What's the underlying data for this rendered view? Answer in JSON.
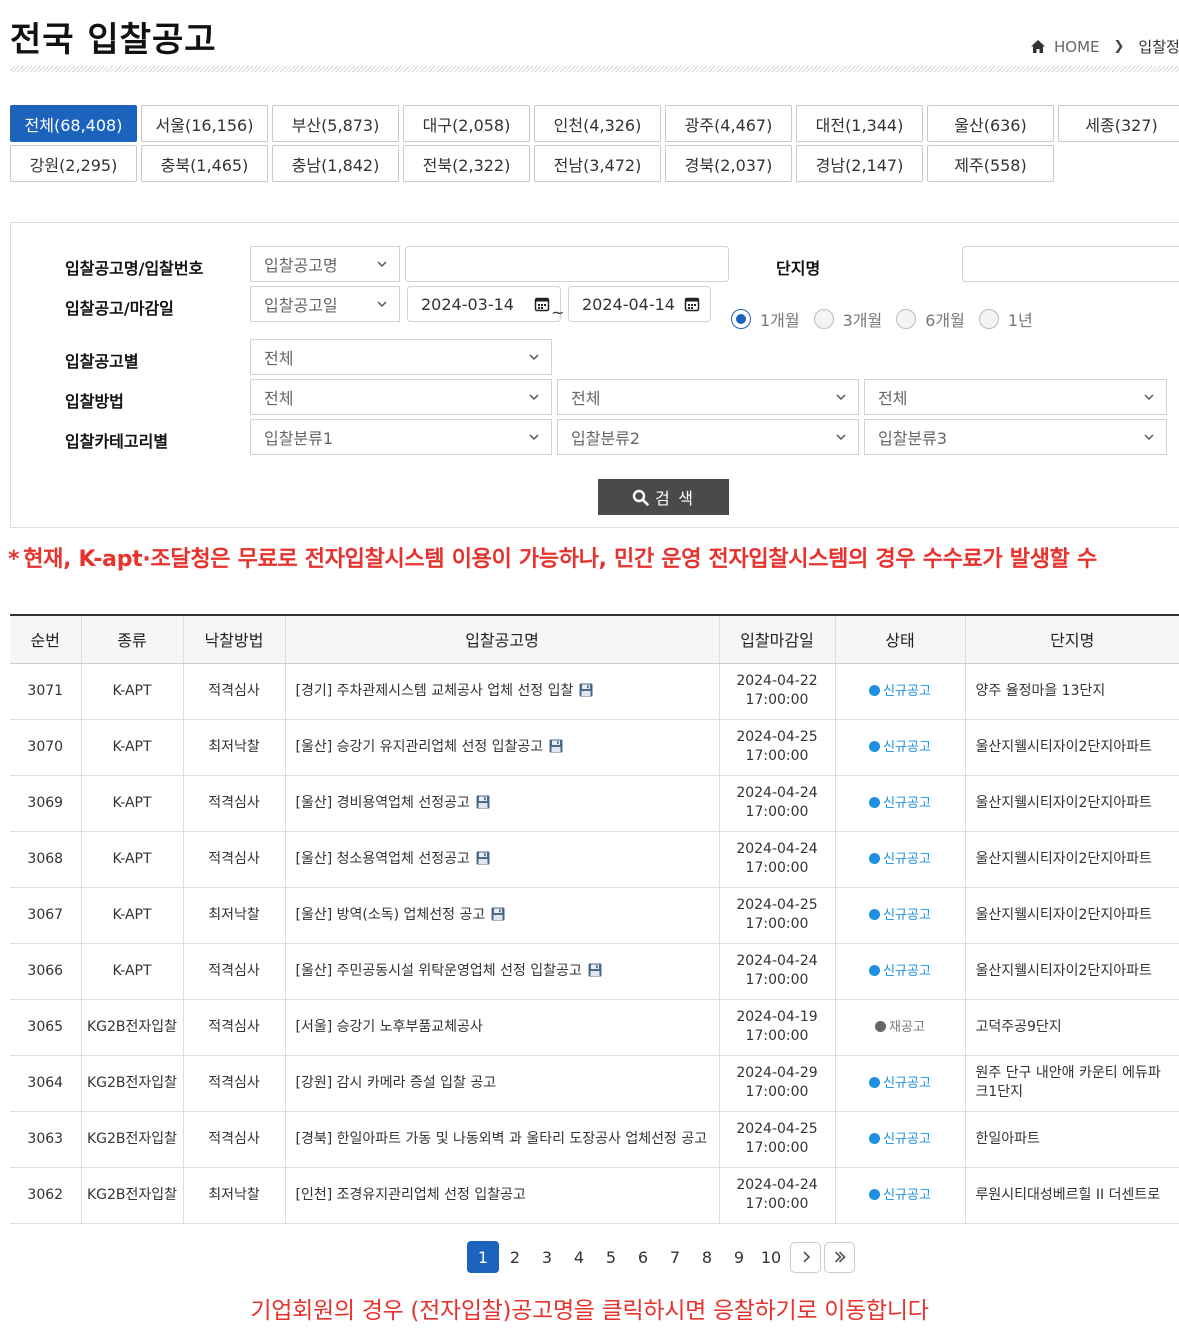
{
  "header": {
    "title": "전국 입찰공고",
    "breadcrumb": {
      "home": "HOME",
      "current": "입찰정!"
    }
  },
  "regions": [
    {
      "label": "전체(68,408)",
      "active": true
    },
    {
      "label": "서울(16,156)"
    },
    {
      "label": "부산(5,873)"
    },
    {
      "label": "대구(2,058)"
    },
    {
      "label": "인천(4,326)"
    },
    {
      "label": "광주(4,467)"
    },
    {
      "label": "대전(1,344)"
    },
    {
      "label": "울산(636)"
    },
    {
      "label": "세종(327)"
    },
    {
      "label": "강원(2,295)"
    },
    {
      "label": "충북(1,465)"
    },
    {
      "label": "충남(1,842)"
    },
    {
      "label": "전북(2,322)"
    },
    {
      "label": "전남(3,472)"
    },
    {
      "label": "경북(2,037)"
    },
    {
      "label": "경남(2,147)"
    },
    {
      "label": "제주(558)"
    }
  ],
  "search": {
    "label_name_number": "입찰공고명/입찰번호",
    "name_type": "입찰공고명",
    "name_value": "",
    "label_complex": "단지명",
    "complex_value": "",
    "label_date": "입찰공고/마감일",
    "date_type": "입찰공고일",
    "date_from": "2024-03-14",
    "date_tilde": "~",
    "date_to": "2024-04-14",
    "periods": [
      {
        "label": "1개월",
        "checked": true
      },
      {
        "label": "3개월"
      },
      {
        "label": "6개월"
      },
      {
        "label": "1년"
      }
    ],
    "label_type": "입찰공고별",
    "type_value": "전체",
    "label_method": "입찰방법",
    "method_values": [
      "전체",
      "전체",
      "전체"
    ],
    "label_category": "입찰카테고리별",
    "category_values": [
      "입찰분류1",
      "입찰분류2",
      "입찰분류3"
    ],
    "button": "검 색"
  },
  "notice": "현재, K-apt·조달청은 무료로 전자입찰시스템 이용이 가능하나, 민간 운영 전자입찰시스템의 경우 수수료가 발생할 수",
  "notice_star": "*",
  "table": {
    "columns": [
      "순번",
      "종류",
      "낙찰방법",
      "입찰공고명",
      "입찰마감일",
      "상태",
      "단지명"
    ],
    "rows": [
      {
        "no": "3071",
        "kind": "K-APT",
        "method": "적격심사",
        "title": "[경기] 주차관제시스템 교체공사 업체 선정 입찰",
        "file": true,
        "date": "2024-04-22",
        "time": "17:00:00",
        "status": "신규공고",
        "status_type": "new",
        "complex": "양주 율정마을 13단지"
      },
      {
        "no": "3070",
        "kind": "K-APT",
        "method": "최저낙찰",
        "title": "[울산] 승강기 유지관리업체 선정 입찰공고",
        "file": true,
        "date": "2024-04-25",
        "time": "17:00:00",
        "status": "신규공고",
        "status_type": "new",
        "complex": "울산지웰시티자이2단지아파트"
      },
      {
        "no": "3069",
        "kind": "K-APT",
        "method": "적격심사",
        "title": "[울산] 경비용역업체 선정공고",
        "file": true,
        "date": "2024-04-24",
        "time": "17:00:00",
        "status": "신규공고",
        "status_type": "new",
        "complex": "울산지웰시티자이2단지아파트"
      },
      {
        "no": "3068",
        "kind": "K-APT",
        "method": "적격심사",
        "title": "[울산] 청소용역업체 선정공고",
        "file": true,
        "date": "2024-04-24",
        "time": "17:00:00",
        "status": "신규공고",
        "status_type": "new",
        "complex": "울산지웰시티자이2단지아파트"
      },
      {
        "no": "3067",
        "kind": "K-APT",
        "method": "최저낙찰",
        "title": "[울산] 방역(소독) 업체선정 공고",
        "file": true,
        "date": "2024-04-25",
        "time": "17:00:00",
        "status": "신규공고",
        "status_type": "new",
        "complex": "울산지웰시티자이2단지아파트"
      },
      {
        "no": "3066",
        "kind": "K-APT",
        "method": "적격심사",
        "title": "[울산] 주민공동시설 위탁운영업체 선정 입찰공고",
        "file": true,
        "date": "2024-04-24",
        "time": "17:00:00",
        "status": "신규공고",
        "status_type": "new",
        "complex": "울산지웰시티자이2단지아파트"
      },
      {
        "no": "3065",
        "kind": "KG2B전자입찰",
        "method": "적격심사",
        "title": "[서울] 승강기 노후부품교체공사",
        "file": false,
        "date": "2024-04-19",
        "time": "17:00:00",
        "status": "재공고",
        "status_type": "re",
        "complex": "고덕주공9단지"
      },
      {
        "no": "3064",
        "kind": "KG2B전자입찰",
        "method": "적격심사",
        "title": "[강원] 감시 카메라 증설 입찰 공고",
        "file": false,
        "date": "2024-04-29",
        "time": "17:00:00",
        "status": "신규공고",
        "status_type": "new",
        "complex": "원주 단구 내안애 카운티 에듀파크1단지"
      },
      {
        "no": "3063",
        "kind": "KG2B전자입찰",
        "method": "적격심사",
        "title": "[경북] 한일아파트 가동 및 나동외벽 과 울타리 도장공사 업체선정 공고",
        "file": false,
        "date": "2024-04-25",
        "time": "17:00:00",
        "status": "신규공고",
        "status_type": "new",
        "complex": "한일아파트"
      },
      {
        "no": "3062",
        "kind": "KG2B전자입찰",
        "method": "최저낙찰",
        "title": "[인천] 조경유지관리업체 선정 입찰공고",
        "file": false,
        "date": "2024-04-24",
        "time": "17:00:00",
        "status": "신규공고",
        "status_type": "new",
        "complex": "루원시티대성베르힐 II 더센트로"
      }
    ]
  },
  "pagination": {
    "pages": [
      "1",
      "2",
      "3",
      "4",
      "5",
      "6",
      "7",
      "8",
      "9",
      "10"
    ],
    "current": "1"
  },
  "footer_notice": "기업회원의 경우 (전자입찰)공고명을 클릭하시면 응찰하기로 이동합니다",
  "colors": {
    "accent": "#1b63bd",
    "notice_red": "#e8322d",
    "status_new": "#1e8fe0",
    "status_re": "#777777"
  },
  "icons": [
    "home-icon",
    "chevron-right-icon",
    "chevron-down-icon",
    "calendar-icon",
    "search-icon",
    "floppy-disk-icon",
    "next-page-icon",
    "last-page-icon"
  ]
}
